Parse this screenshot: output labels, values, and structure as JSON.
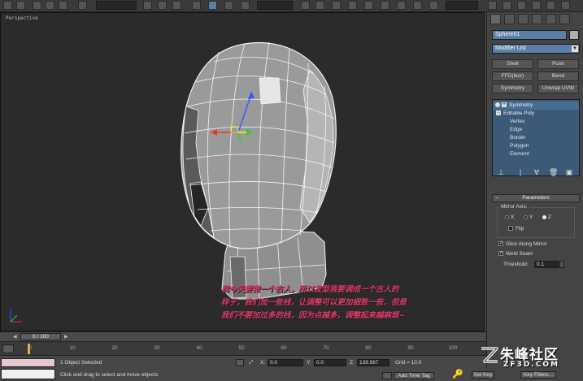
{
  "viewport": {
    "label": "Perspective"
  },
  "command_panel": {
    "object_name": "Sphere01",
    "modifier_list": "Modifier List",
    "buttons": [
      "Shell",
      "Push",
      "FFD(box)",
      "Bend",
      "Symmetry",
      "Unwrap UVW"
    ],
    "stack": {
      "top_item": "Symmetry",
      "base_item": "Editable Poly",
      "sub_objects": [
        "Vertex",
        "Edge",
        "Border",
        "Polygon",
        "Element"
      ]
    },
    "parameters": {
      "title": "Parameters",
      "mirror_axis_label": "Mirror Axis:",
      "axes": [
        "X",
        "Y",
        "Z"
      ],
      "selected_axis": "Z",
      "flip_label": "Flip",
      "slice_label": "Slice Along Mirror",
      "weld_label": "Weld Seam",
      "threshold_label": "Threshold:",
      "threshold_value": "0.1"
    }
  },
  "timeline": {
    "slider_label": "0 / 100",
    "ticks": [
      "0",
      "10",
      "20",
      "30",
      "40",
      "50",
      "60",
      "70",
      "80",
      "90",
      "100"
    ]
  },
  "status_bar": {
    "selection_text": "1 Object Selected",
    "prompt_text": "Click and drag to select and move objects",
    "x_label": "X:",
    "x_value": "0.0",
    "y_label": "Y:",
    "y_value": "0.0",
    "z_label": "Z:",
    "z_value": "139.567",
    "grid_text": "Grid = 10.0",
    "add_time_tag": "Add Time Tag",
    "set_key": "Set Key",
    "key_filters": "Key Filters..."
  },
  "caption": {
    "line1": "我今天要做一个古人，所以发型我要调成一个古人的",
    "line2": "样子，我们加一些线，让调整可以更加细致一些，但是",
    "line3": "我们不要加过多的线，因为点越多，调整起来越麻烦~"
  },
  "watermark": {
    "cn": "朱峰社区",
    "en": "ZF3D.COM"
  },
  "colors": {
    "accent": "#5a7fa8",
    "stack_bg": "#3c5a78",
    "caption": "#e03a6a"
  }
}
